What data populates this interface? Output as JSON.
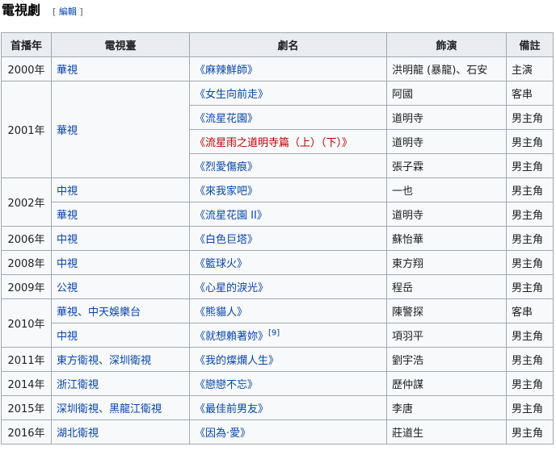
{
  "section": {
    "title": "電視劇",
    "edit_label": "編輯",
    "bracket_open": "[",
    "bracket_close": "]"
  },
  "table": {
    "headers": [
      "首播年",
      "電視臺",
      "劇名",
      "飾演",
      "備註"
    ],
    "rows": [
      {
        "year": "2000年",
        "station": "華視",
        "title": "《麻辣鮮師》",
        "role": "洪明龍 (暴龍)、石安",
        "note": "主演"
      },
      {
        "year": "2001年",
        "station": "華視",
        "title": "《女生向前走》",
        "role": "阿國",
        "note": "客串"
      },
      {
        "title": "《流星花園》",
        "role": "道明寺",
        "note": "男主角"
      },
      {
        "title": "《流星雨之道明寺篇（上）（下）》",
        "role": "道明寺",
        "note": "男主角"
      },
      {
        "title": "《烈愛傷痕》",
        "role": "張子霖",
        "note": "男主角"
      },
      {
        "year": "2002年",
        "station": "中視",
        "title": "《來我家吧》",
        "role": "一也",
        "note": "男主角"
      },
      {
        "station": "華視",
        "title": "《流星花園 II》",
        "role": "道明寺",
        "note": "男主角"
      },
      {
        "year": "2006年",
        "station": "中視",
        "title": "《白色巨塔》",
        "role": "蘇怡華",
        "note": "男主角"
      },
      {
        "year": "2008年",
        "station": "中視",
        "title": "《籃球火》",
        "role": "東方翔",
        "note": "男主角"
      },
      {
        "year": "2009年",
        "station": "公視",
        "title": "《心星的淚光》",
        "role": "程岳",
        "note": "男主角"
      },
      {
        "year": "2010年",
        "station": "華視、中天娛樂台",
        "title": "《熊貓人》",
        "role": "陳警探",
        "note": "客串"
      },
      {
        "station": "中視",
        "title": "《就想賴著妳》",
        "ref": "[9]",
        "role": "項羽平",
        "note": "男主角"
      },
      {
        "year": "2011年",
        "station": "東方衛視、深圳衛視",
        "title": "《我的燦爛人生》",
        "role": "劉宇浩",
        "note": "男主角"
      },
      {
        "year": "2014年",
        "station": "浙江衛視",
        "title": "《戀戀不忘》",
        "role": "歷仲謀",
        "note": "男主角"
      },
      {
        "year": "2015年",
        "station": "深圳衛視、黑龍江衛視",
        "title": "《最佳前男友》",
        "role": "李唐",
        "note": "男主角"
      },
      {
        "year": "2016年",
        "station": "湖北衛視",
        "title": "《因為·愛》",
        "role": "莊道生",
        "note": "男主角"
      }
    ]
  }
}
